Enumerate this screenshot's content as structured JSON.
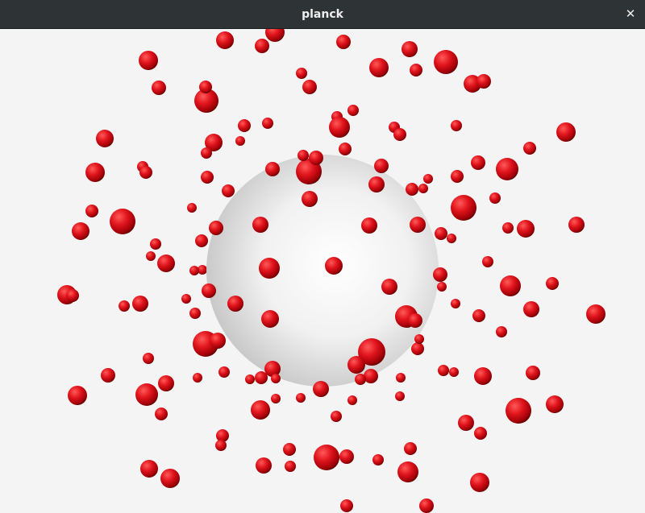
{
  "window": {
    "title": "planck",
    "close_glyph": "✕",
    "close_icon": "close-icon"
  },
  "scene": {
    "background_color": "#f4f4f4",
    "central_sphere_color": "#ffffff",
    "central_sphere_shade": "#c8c8c8",
    "particle_color": "#e0141c",
    "particle_shade": "#6a0000",
    "particle_highlight": "#ff6a6a",
    "particle_count": 187
  }
}
